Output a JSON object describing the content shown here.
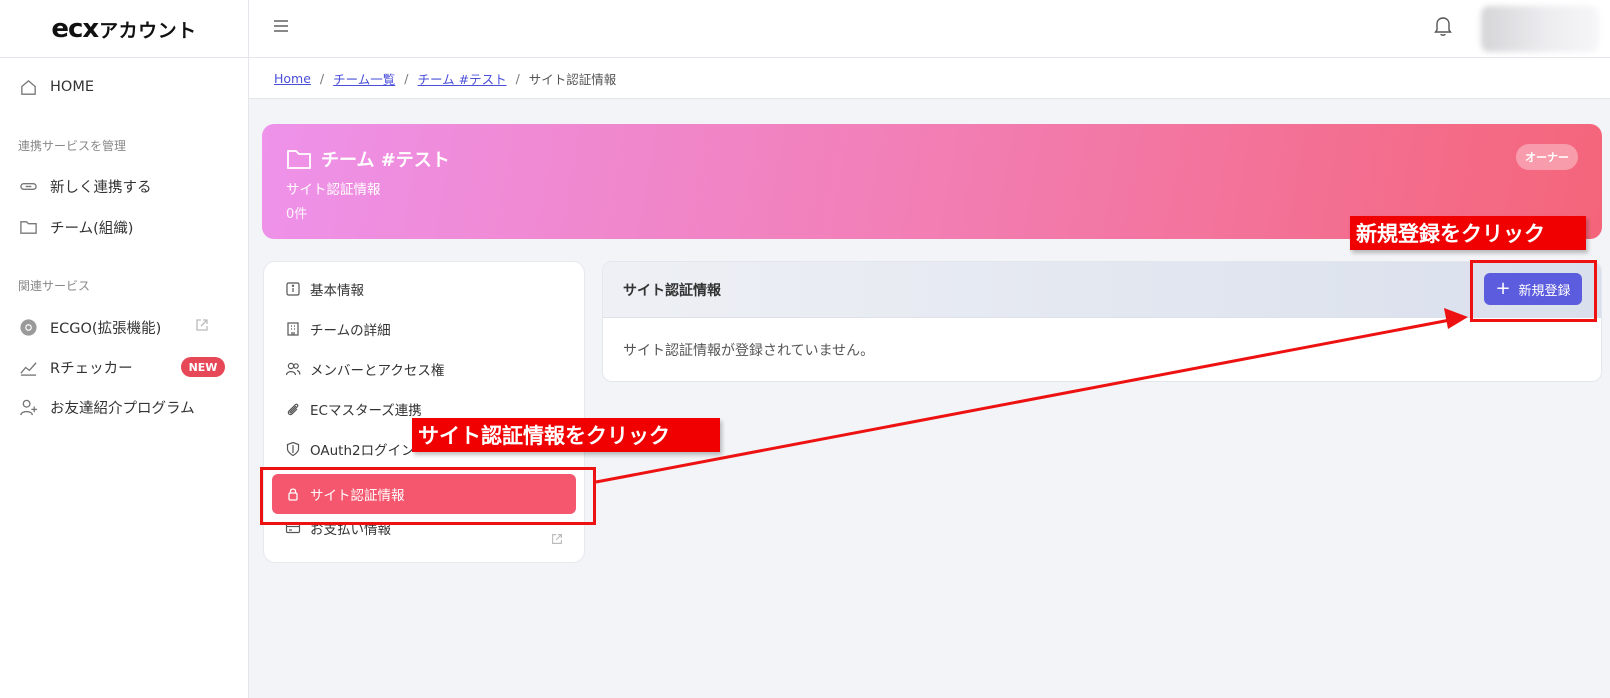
{
  "app": {
    "logo_big": "ecx",
    "logo_rest": "アカウント"
  },
  "sidebar": {
    "home": "HOME",
    "section_manage": "連携サービスを管理",
    "new_link": "新しく連携する",
    "team": "チーム(組織)",
    "section_related": "関連サービス",
    "ecgo": "ECGO(拡張機能)",
    "rchecker": "Rチェッカー",
    "new_badge": "NEW",
    "referral": "お友達紹介プログラム"
  },
  "breadcrumb": {
    "home": "Home",
    "team_list": "チーム一覧",
    "team": "チーム #テスト",
    "current": "サイト認証情報",
    "sep": "/"
  },
  "hero": {
    "title": "チーム #テスト",
    "subtitle": "サイト認証情報",
    "count": "0件",
    "role_badge": "オーナー"
  },
  "menu": {
    "basic": "基本情報",
    "team_detail": "チームの詳細",
    "members": "メンバーとアクセス権",
    "ecmasters": "ECマスターズ連携",
    "oauth": "OAuth2ログイン",
    "site_auth": "サイト認証情報",
    "payment": "お支払い情報"
  },
  "content": {
    "header": "サイト認証情報",
    "empty": "サイト認証情報が登録されていません。",
    "new_button": "新規登録",
    "new_button_plus": "+"
  },
  "annotations": {
    "click_new": "新規登録をクリック",
    "click_site": "サイト認証情報をクリック"
  },
  "colors": {
    "accent": "#5c5cde",
    "active_menu": "#f4576e",
    "annotation": "#ee1111",
    "badge_new": "#e64857"
  }
}
